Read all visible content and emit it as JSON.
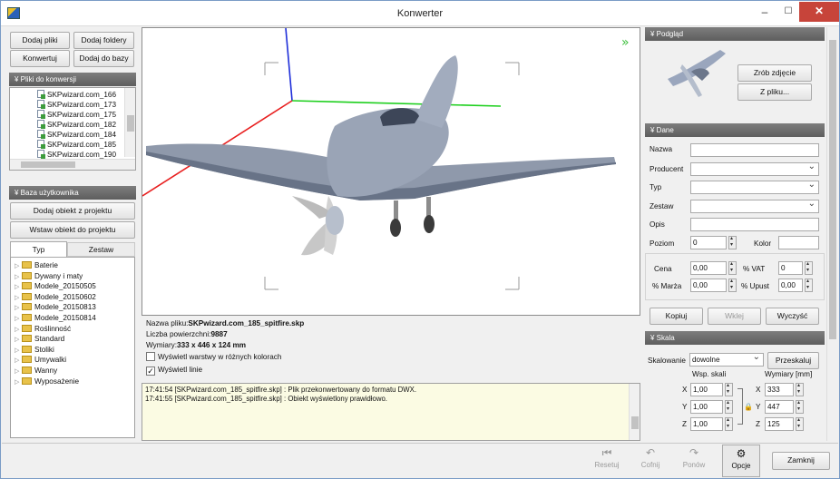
{
  "window": {
    "title": "Konwerter",
    "controls": {
      "minimize": "–",
      "maximize": "☐",
      "close": "✕"
    }
  },
  "left": {
    "buttons": {
      "add_files": "Dodaj pliki",
      "add_folders": "Dodaj foldery",
      "convert": "Konwertuj",
      "add_to_db": "Dodaj do bazy"
    },
    "files_header": "Pliki do konwersji",
    "files": [
      "SKPwizard.com_166",
      "SKPwizard.com_173",
      "SKPwizard.com_175",
      "SKPwizard.com_182",
      "SKPwizard.com_184",
      "SKPwizard.com_185",
      "SKPwizard.com_190"
    ],
    "userdb_header": "Baza użytkownika",
    "db_buttons": {
      "add_from_project": "Dodaj obiekt z projektu",
      "insert_to_project": "Wstaw obiekt do projektu"
    },
    "tabs": [
      "Typ",
      "Zestaw"
    ],
    "categories": [
      "Baterie",
      "Dywany i maty",
      "Modele_20150505",
      "Modele_20150602",
      "Modele_20150813",
      "Modele_20150814",
      "Roślinność",
      "Standard",
      "Stoliki",
      "Umywalki",
      "Wanny",
      "Wyposażenie"
    ]
  },
  "viewport": {
    "expand_icon": "»",
    "info": {
      "file_label": "Nazwa pliku:",
      "file_value": "SKPwizard.com_185_spitfire.skp",
      "surfaces_label": "Liczba powierzchni:",
      "surfaces_value": "9887",
      "dims_label": "Wymiary:",
      "dims_value": "333 x 446 x 124 mm",
      "opt_layers": "Wyświetl warstwy w różnych kolorach",
      "opt_lines": "Wyświetl linie"
    },
    "log": [
      "17:41:54 [SKPwizard.com_185_spitfire.skp] : Plik przekonwertowany do formatu DWX.",
      "17:41:55 [SKPwizard.com_185_spitfire.skp] : Obiekt wyświetlony prawidłowo."
    ]
  },
  "right": {
    "preview_header": "Podgląd",
    "preview_buttons": {
      "snapshot": "Zrób zdjęcie",
      "from_file": "Z pliku..."
    },
    "data_header": "Dane",
    "labels": {
      "name": "Nazwa",
      "producer": "Producent",
      "type": "Typ",
      "set": "Zestaw",
      "desc": "Opis",
      "level": "Poziom",
      "color": "Kolor",
      "price": "Cena",
      "vat": "% VAT",
      "margin": "% Marża",
      "discount": "% Upust"
    },
    "values": {
      "level": "0",
      "price": "0,00",
      "vat": "0",
      "margin": "0,00",
      "discount": "0,00"
    },
    "data_buttons": {
      "copy": "Kopiuj",
      "paste": "Wklej",
      "clear": "Wyczyść"
    },
    "scale_header": "Skala",
    "scaling_label": "Skalowanie",
    "scaling_value": "dowolne",
    "rescale_button": "Przeskaluj",
    "scale_col": "Wsp. skali",
    "dims_col": "Wymiary [mm]",
    "axes": [
      "X",
      "Y",
      "Z"
    ],
    "scale_values": [
      "1,00",
      "1,00",
      "1,00"
    ],
    "dim_values": [
      "333",
      "447",
      "125"
    ]
  },
  "toolbar": {
    "reset": "Resetuj",
    "undo": "Cofnij",
    "redo": "Ponów",
    "options": "Opcje",
    "close": "Zamknij"
  },
  "colors": {
    "header_bg": "#6b6b6b",
    "close_btn": "#c7443a",
    "log_bg": "#fbfbe3"
  }
}
